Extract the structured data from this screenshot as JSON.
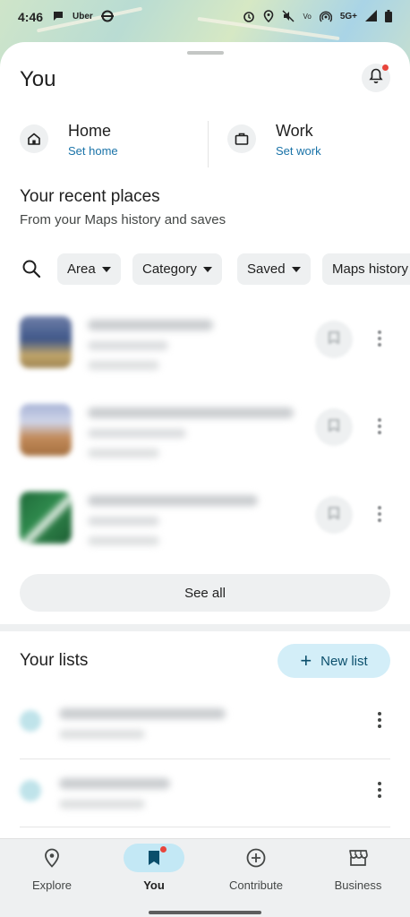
{
  "status_bar": {
    "time": "4:46",
    "left_icons": [
      "message-icon",
      "uber-icon",
      "transit-icon"
    ],
    "uber_label": "Uber",
    "right_icons": [
      "alarm-icon",
      "location-icon",
      "mute-icon",
      "volte-icon",
      "hotspot-icon",
      "5g-icon",
      "signal-icon",
      "battery-icon"
    ],
    "network": "5G+"
  },
  "header": {
    "title": "You",
    "notification_dot_color": "#e8453c"
  },
  "places": {
    "home": {
      "label": "Home",
      "action": "Set home",
      "icon": "home-icon"
    },
    "work": {
      "label": "Work",
      "action": "Set work",
      "icon": "briefcase-icon"
    }
  },
  "recent": {
    "title": "Your recent places",
    "subtitle": "From your Maps history and saves",
    "filters": [
      "Area",
      "Category",
      "Saved",
      "Maps history"
    ],
    "see_all": "See all"
  },
  "lists": {
    "title": "Your lists",
    "new_list": "New list"
  },
  "nav": {
    "items": [
      {
        "label": "Explore",
        "icon": "location-pin-icon"
      },
      {
        "label": "You",
        "icon": "bookmark-icon"
      },
      {
        "label": "Contribute",
        "icon": "add-circle-icon"
      },
      {
        "label": "Business",
        "icon": "storefront-icon"
      }
    ],
    "active_index": 1,
    "accent": "#c3e8f5"
  },
  "colors": {
    "link": "#1a73a8",
    "chip_bg": "#eef0f1",
    "new_list_bg": "#d3eef8"
  }
}
